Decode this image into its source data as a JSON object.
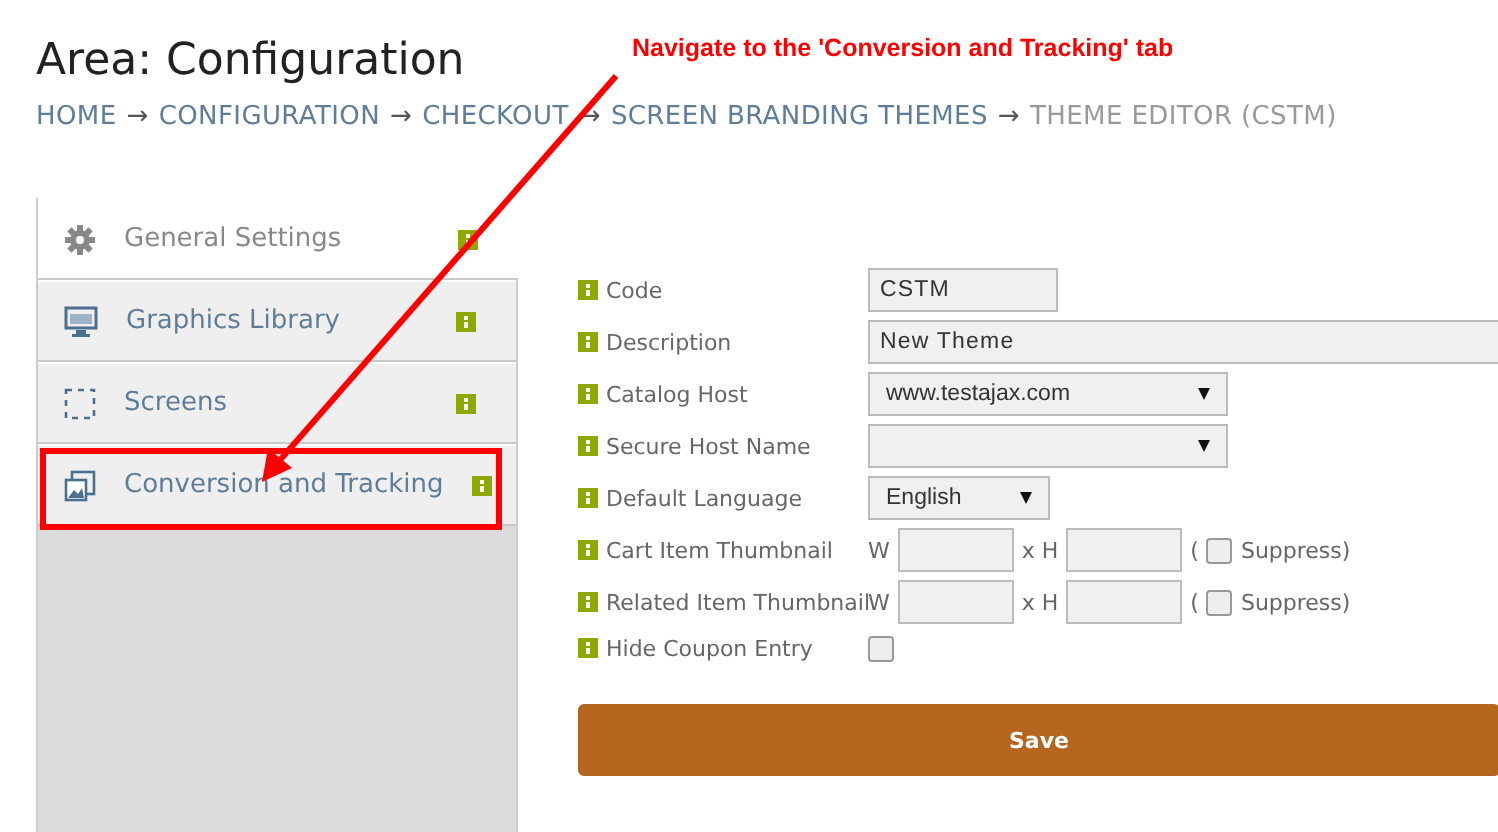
{
  "title": "Area: Configuration",
  "breadcrumb": [
    {
      "label": "HOME",
      "separator": "→",
      "current": false
    },
    {
      "label": "CONFIGURATION",
      "separator": "→",
      "current": false
    },
    {
      "label": "CHECKOUT",
      "separator": "→",
      "current": false
    },
    {
      "label": "SCREEN BRANDING THEMES",
      "separator": "→",
      "current": false
    },
    {
      "label": "THEME EDITOR (CSTM)",
      "current": true
    }
  ],
  "sidebar": {
    "items": [
      {
        "label": "General Settings",
        "selected": true,
        "highlighted": false
      },
      {
        "label": "Graphics Library",
        "selected": false,
        "highlighted": false
      },
      {
        "label": "Screens",
        "selected": false,
        "highlighted": false
      },
      {
        "label": "Conversion and Tracking",
        "selected": false,
        "highlighted": true
      }
    ]
  },
  "form": {
    "fields": [
      {
        "kind": "text",
        "label": "Code",
        "value": "CSTM"
      },
      {
        "kind": "text",
        "label": "Description",
        "value": "New Theme"
      },
      {
        "kind": "select",
        "label": "Catalog Host",
        "value": "www.testajax.com"
      },
      {
        "kind": "select",
        "label": "Secure Host Name"
      },
      {
        "kind": "select",
        "label": "Default Language",
        "value": "English"
      },
      {
        "kind": "dimensions",
        "label": "Cart Item Thumbnail",
        "w_label": "W",
        "h_label": "x H",
        "suppress_open": "(",
        "suppress_label": "Suppress)",
        "checked": false
      },
      {
        "kind": "dimensions",
        "label": "Related Item Thumbnail",
        "w_label": "W",
        "h_label": "x H",
        "suppress_open": "(",
        "suppress_label": "Suppress)",
        "checked": false
      },
      {
        "kind": "checkbox",
        "label": "Hide Coupon Entry",
        "checked": false
      }
    ],
    "save_button": "Save"
  },
  "annotation": {
    "text": "Navigate to the 'Conversion and Tracking' tab"
  }
}
